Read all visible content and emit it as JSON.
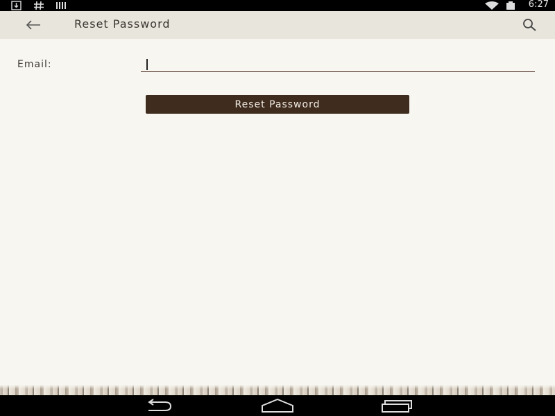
{
  "status_bar": {
    "time": "6:27",
    "left_icons": [
      "download-icon",
      "hash-icon",
      "signal-bars-icon"
    ],
    "right_icons": [
      "wifi-icon",
      "battery-icon"
    ]
  },
  "app_bar": {
    "title": "Reset Password",
    "back_icon": "arrow-left-icon",
    "search_icon": "search-icon",
    "background": "#e8e6dc"
  },
  "form": {
    "email_label": "Email:",
    "email_value": "",
    "reset_button_label": "Reset Password",
    "button_color": "#3f2c1f"
  },
  "nav_bar": {
    "icons": [
      "back-nav-icon",
      "home-nav-icon",
      "recents-nav-icon"
    ]
  },
  "colors": {
    "background": "#f7f6f0",
    "status_bar": "#000000",
    "accent": "#3f2c1f"
  }
}
